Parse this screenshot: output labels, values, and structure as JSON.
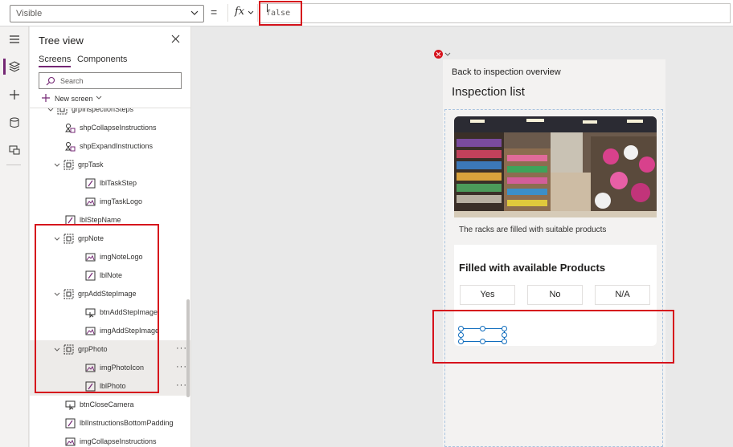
{
  "formula_bar": {
    "property": "Visible",
    "equals": "=",
    "fx_label": "fx",
    "formula": "false"
  },
  "rail": {
    "icons": [
      "hamburger-icon",
      "layers-icon",
      "plus-icon",
      "database-icon",
      "media-icon"
    ]
  },
  "tree_view": {
    "title": "Tree view",
    "tabs": [
      "Screens",
      "Components"
    ],
    "search_placeholder": "Search",
    "new_screen_label": "New screen",
    "nodes": [
      {
        "label": "grpInspectionSteps",
        "type": "group",
        "depth": 1
      },
      {
        "label": "shpCollapseInstructions",
        "type": "shape",
        "depth": 2
      },
      {
        "label": "shpExpandInstructions",
        "type": "shape",
        "depth": 2
      },
      {
        "label": "grpTask",
        "type": "group",
        "depth": 2
      },
      {
        "label": "lblTaskStep",
        "type": "label",
        "depth": 3
      },
      {
        "label": "imgTaskLogo",
        "type": "image",
        "depth": 3
      },
      {
        "label": "lblStepName",
        "type": "label",
        "depth": 2
      },
      {
        "label": "grpNote",
        "type": "group",
        "depth": 2
      },
      {
        "label": "imgNoteLogo",
        "type": "image",
        "depth": 3
      },
      {
        "label": "lblNote",
        "type": "label",
        "depth": 3
      },
      {
        "label": "grpAddStepImage",
        "type": "group",
        "depth": 2
      },
      {
        "label": "btnAddStepImage",
        "type": "button",
        "depth": 3
      },
      {
        "label": "imgAddStepImage",
        "type": "image",
        "depth": 3
      },
      {
        "label": "grpPhoto",
        "type": "group",
        "depth": 2,
        "selected": true
      },
      {
        "label": "imgPhotoIcon",
        "type": "image",
        "depth": 3,
        "selected": true
      },
      {
        "label": "lblPhoto",
        "type": "label",
        "depth": 3,
        "selected": true
      },
      {
        "label": "btnCloseCamera",
        "type": "button",
        "depth": 2
      },
      {
        "label": "lblInstructionsBottomPadding",
        "type": "label",
        "depth": 2
      },
      {
        "label": "imgCollapseInstructions",
        "type": "image",
        "depth": 2
      }
    ],
    "more_glyph": "···"
  },
  "app": {
    "back_link": "Back to inspection overview",
    "title": "Inspection list",
    "card": {
      "caption": "The racks are filled with suitable products",
      "question": "Filled with available Products",
      "choices": [
        "Yes",
        "No",
        "N/A"
      ]
    }
  },
  "colors": {
    "accent": "#742774",
    "highlight_red": "#d6121c",
    "selection_blue": "#0f6cbd"
  }
}
